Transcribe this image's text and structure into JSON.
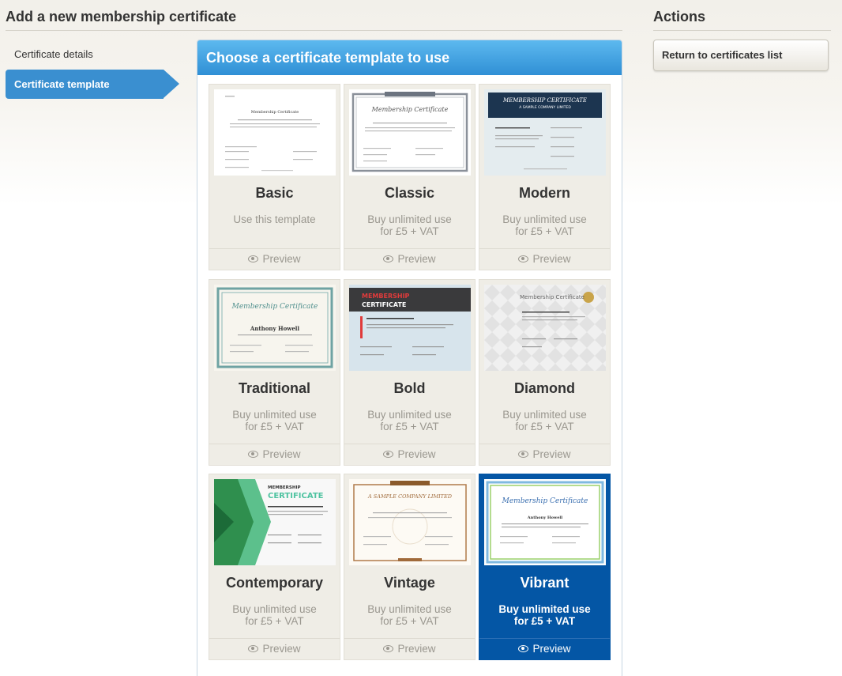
{
  "header": {
    "page_title": "Add a new membership certificate",
    "actions_title": "Actions"
  },
  "sidebar": {
    "items": [
      {
        "label": "Certificate details",
        "active": false
      },
      {
        "label": "Certificate template",
        "active": true
      }
    ]
  },
  "actions": {
    "return_label": "Return to certificates list"
  },
  "panel": {
    "title": "Choose a certificate template to use",
    "templates": [
      {
        "name": "Basic",
        "sub_line1": "Use this template",
        "sub_line2": "",
        "preview": "Preview",
        "selected": false
      },
      {
        "name": "Classic",
        "sub_line1": "Buy unlimited use",
        "sub_line2": "for £5 + VAT",
        "preview": "Preview",
        "selected": false
      },
      {
        "name": "Modern",
        "sub_line1": "Buy unlimited use",
        "sub_line2": "for £5 + VAT",
        "preview": "Preview",
        "selected": false
      },
      {
        "name": "Traditional",
        "sub_line1": "Buy unlimited use",
        "sub_line2": "for £5 + VAT",
        "preview": "Preview",
        "selected": false
      },
      {
        "name": "Bold",
        "sub_line1": "Buy unlimited use",
        "sub_line2": "for £5 + VAT",
        "preview": "Preview",
        "selected": false
      },
      {
        "name": "Diamond",
        "sub_line1": "Buy unlimited use",
        "sub_line2": "for £5 + VAT",
        "preview": "Preview",
        "selected": false
      },
      {
        "name": "Contemporary",
        "sub_line1": "Buy unlimited use",
        "sub_line2": "for £5 + VAT",
        "preview": "Preview",
        "selected": false
      },
      {
        "name": "Vintage",
        "sub_line1": "Buy unlimited use",
        "sub_line2": "for £5 + VAT",
        "preview": "Preview",
        "selected": false
      },
      {
        "name": "Vibrant",
        "sub_line1": "Buy unlimited use",
        "sub_line2": "for £5 + VAT",
        "preview": "Preview",
        "selected": true
      }
    ]
  },
  "thumb_text": {
    "basic_title": "Membership Certificate",
    "classic_title": "Membership Certificate",
    "modern_title": "MEMBERSHIP CERTIFICATE",
    "modern_sub": "A SAMPLE COMPANY LIMITED",
    "traditional_title": "Membership Certificate",
    "traditional_name": "Anthony Howell",
    "bold_title1": "MEMBERSHIP",
    "bold_title2": "CERTIFICATE",
    "diamond_title": "Membership Certificate",
    "contemporary_title1": "MEMBERSHIP",
    "contemporary_title2": "CERTIFICATE",
    "vintage_title": "A SAMPLE COMPANY LIMITED",
    "vibrant_title": "Membership Certificate",
    "vibrant_name": "Anthony Howell"
  },
  "colors": {
    "accent_blue": "#3a8fd0",
    "selected_card": "#0456a5",
    "panel_header": "#2f8fd5"
  }
}
